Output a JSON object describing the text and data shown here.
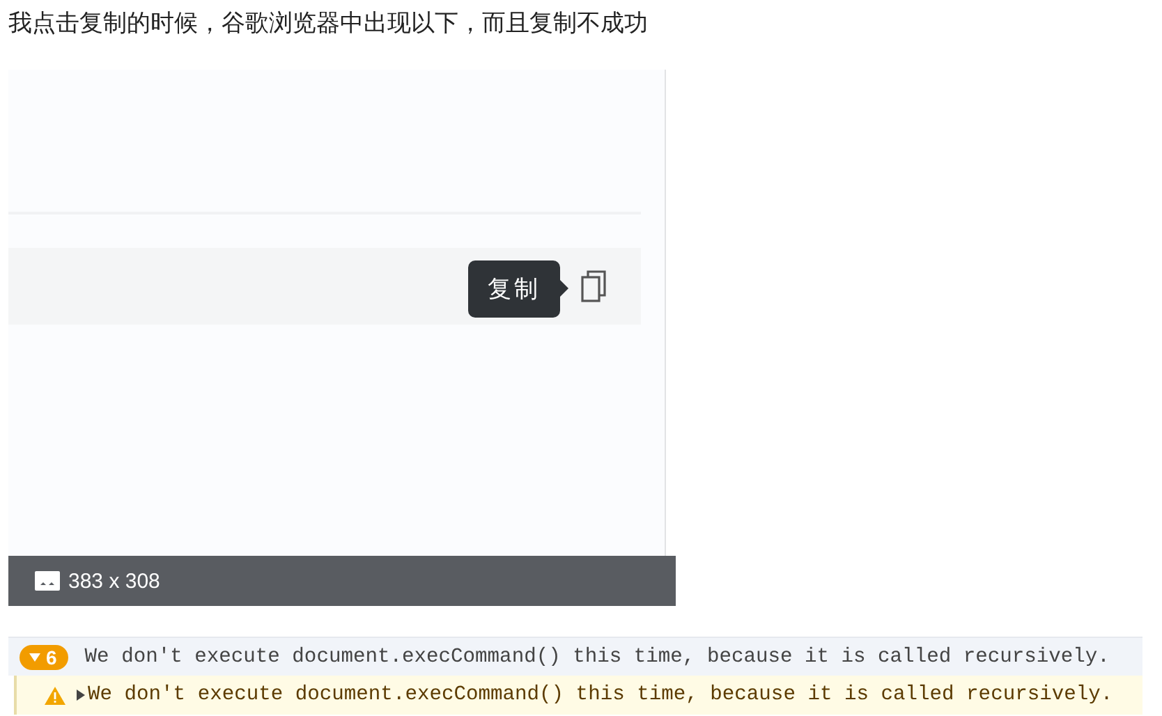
{
  "question": "我点击复制的时候，谷歌浏览器中出现以下，而且复制不成功",
  "figure": {
    "tooltip": "复制",
    "caption": "383 x 308"
  },
  "console": {
    "group": {
      "count": "6",
      "expanded": true,
      "message": "We don't execute document.execCommand() this time, because it is called recursively."
    },
    "entries": [
      {
        "kind": "warning",
        "expanded": false,
        "message": "We don't execute document.execCommand() this time, because it is called recursively."
      }
    ]
  }
}
